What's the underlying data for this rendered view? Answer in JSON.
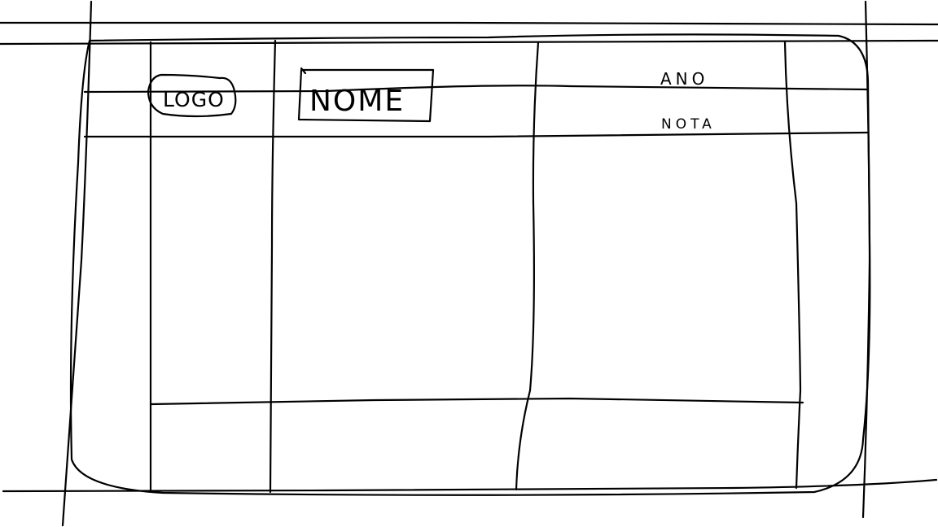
{
  "wireframe": {
    "logo_label": "LOGO",
    "name_label": "NOME",
    "year_label": "ANO",
    "grade_label": "NOTA"
  },
  "colors": {
    "ink": "#000000",
    "paper": "#ffffff"
  }
}
